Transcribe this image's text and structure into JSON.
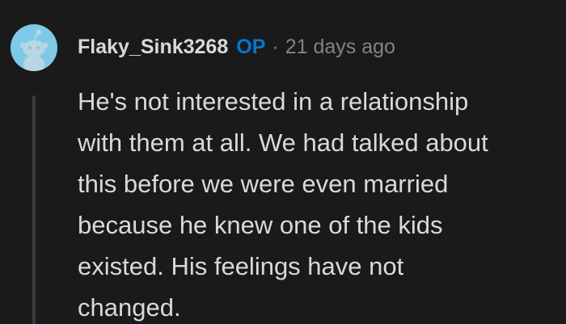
{
  "comment": {
    "author": "Flaky_Sink3268",
    "badge": "OP",
    "separator": "·",
    "timestamp": "21 days ago",
    "avatar_icon": "reddit-snoo-avatar-icon",
    "body": "He's not interested in a relationship\nwith them at all. We had talked about\nthis before we were even married\nbecause he knew one of the kids\nexisted. His feelings have not\nchanged."
  },
  "colors": {
    "background": "#1a1a1b",
    "text": "#d7dadc",
    "muted": "#818384",
    "op_badge": "#0079d3",
    "avatar_bg": "#7ec9e8",
    "thread_line": "#3a3a3c"
  }
}
